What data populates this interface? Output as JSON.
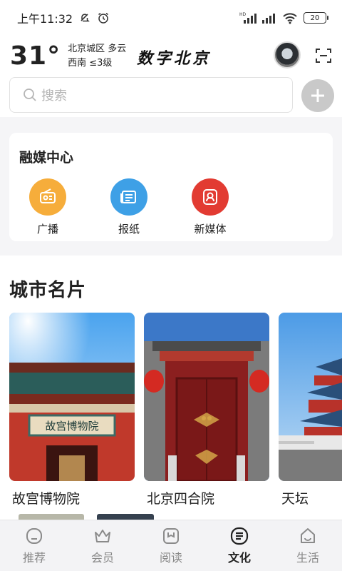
{
  "status_bar": {
    "time": "上午11:32",
    "network_label": "HD",
    "battery": "20"
  },
  "header": {
    "temperature": "31°",
    "location": "北京城区",
    "condition": "多云",
    "wind_direction": "西南",
    "wind_level": "≤3级",
    "brand": "数字北京"
  },
  "search": {
    "placeholder": "搜索"
  },
  "media_center": {
    "title": "融媒中心",
    "items": [
      {
        "label": "广播",
        "icon": "radio-icon",
        "color": "#f6ad3b"
      },
      {
        "label": "报纸",
        "icon": "newspaper-icon",
        "color": "#3ea0e6"
      },
      {
        "label": "新媒体",
        "icon": "new-media-icon",
        "color": "#e23b32"
      }
    ]
  },
  "city_cards": {
    "title": "城市名片",
    "items": [
      {
        "label": "故宫博物院",
        "sign": "故宫博物院"
      },
      {
        "label": "北京四合院"
      },
      {
        "label": "天坛"
      }
    ]
  },
  "tab_bar": {
    "active": "文化",
    "items": [
      {
        "label": "推荐",
        "icon": "recommend-icon"
      },
      {
        "label": "会员",
        "icon": "crown-icon"
      },
      {
        "label": "阅读",
        "icon": "book-icon"
      },
      {
        "label": "文化",
        "icon": "culture-icon"
      },
      {
        "label": "生活",
        "icon": "life-icon"
      }
    ]
  }
}
